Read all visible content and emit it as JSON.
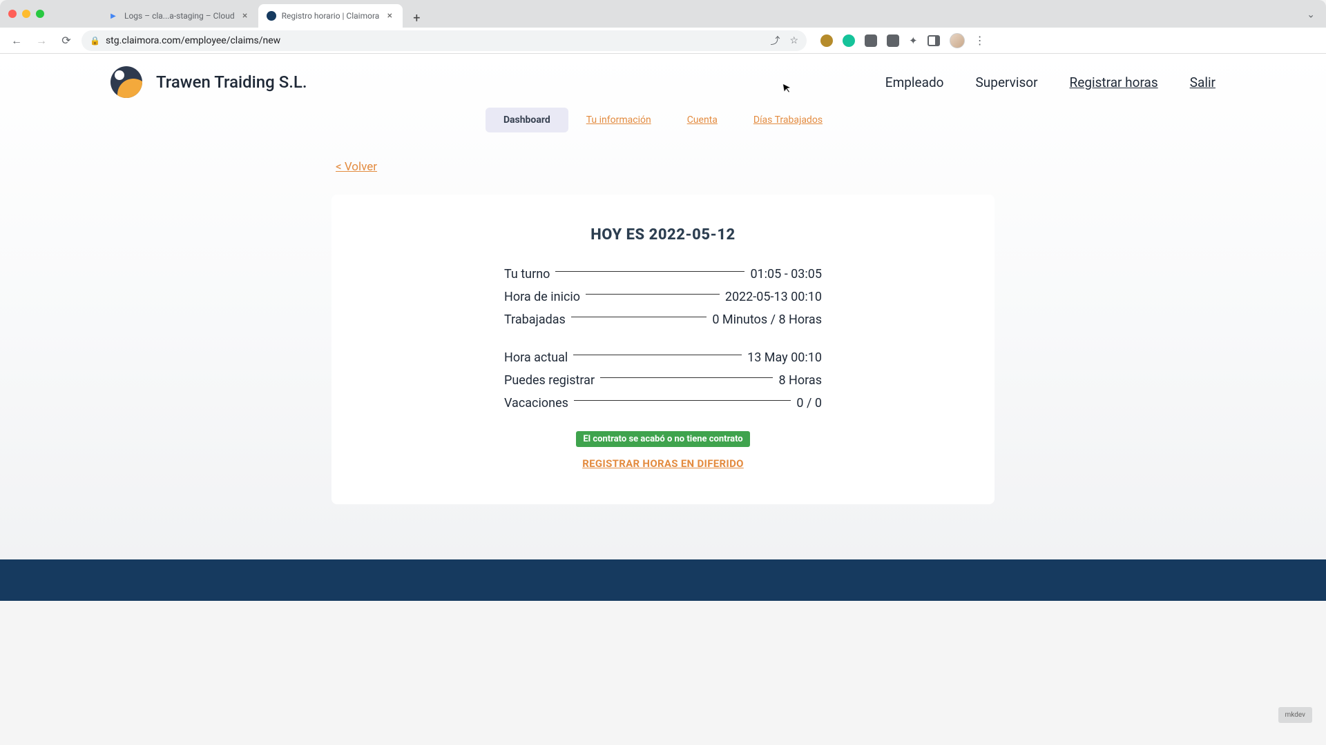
{
  "browser": {
    "tabs": [
      {
        "title": "Logs – cla...a-staging – Cloud",
        "favcolor": "#4285f4"
      },
      {
        "title": "Registro horario | Claimora",
        "favcolor": "#163a5f"
      }
    ],
    "url": "stg.claimora.com/employee/claims/new"
  },
  "header": {
    "brand": "Trawen Traiding S.L.",
    "nav": {
      "empleado": "Empleado",
      "supervisor": "Supervisor",
      "registrar": "Registrar horas",
      "salir": "Salir"
    }
  },
  "subnav": {
    "dashboard": "Dashboard",
    "info": "Tu información",
    "cuenta": "Cuenta",
    "dias": "Días Trabajados"
  },
  "back_label": "< Volver",
  "card": {
    "heading": "HOY ES 2022-05-12",
    "rows1": [
      {
        "label": "Tu turno",
        "value": "01:05 - 03:05"
      },
      {
        "label": "Hora de inicio",
        "value": "2022-05-13 00:10"
      },
      {
        "label": "Trabajadas",
        "value": "0 Minutos / 8 Horas"
      }
    ],
    "rows2": [
      {
        "label": "Hora actual",
        "value": "13 May 00:10"
      },
      {
        "label": "Puedes registrar",
        "value": "8 Horas"
      },
      {
        "label": "Vacaciones",
        "value": "0 / 0"
      }
    ],
    "badge": "El contrato se acabó o no tiene contrato",
    "deferred": "REGISTRAR HORAS EN DIFERIDO"
  },
  "chip": "mkdev"
}
